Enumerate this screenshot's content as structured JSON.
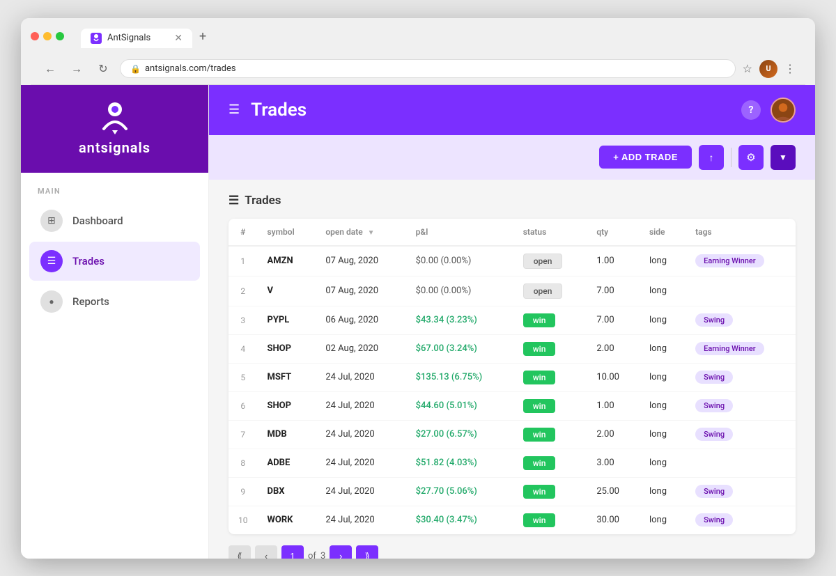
{
  "browser": {
    "tab_title": "AntSignals",
    "tab_favicon": "a",
    "url": "antsignals.com/trades",
    "new_tab_symbol": "+"
  },
  "sidebar": {
    "logo_text_light": "ant",
    "logo_text_bold": "signals",
    "section_label": "MAIN",
    "items": [
      {
        "id": "dashboard",
        "label": "Dashboard",
        "icon": "⊞",
        "active": false
      },
      {
        "id": "trades",
        "label": "Trades",
        "icon": "☰",
        "active": true
      },
      {
        "id": "reports",
        "label": "Reports",
        "icon": "○",
        "active": false
      }
    ]
  },
  "header": {
    "title": "Trades",
    "hamburger": "☰",
    "help_label": "?",
    "user_initials": "U"
  },
  "toolbar": {
    "add_trade_label": "+ ADD TRADE",
    "upload_icon": "↑",
    "settings_icon": "⚙",
    "filter_icon": "▼"
  },
  "trades_section": {
    "heading": "Trades",
    "heading_icon": "☰",
    "columns": [
      "#",
      "symbol",
      "open date",
      "p&l",
      "status",
      "qty",
      "side",
      "tags"
    ],
    "rows": [
      {
        "num": 1,
        "symbol": "AMZN",
        "open_date": "07 Aug, 2020",
        "pnl": "$0.00 (0.00%)",
        "pnl_type": "zero",
        "status": "open",
        "qty": "1.00",
        "side": "long",
        "tags": [
          "Earning Winner"
        ]
      },
      {
        "num": 2,
        "symbol": "V",
        "open_date": "07 Aug, 2020",
        "pnl": "$0.00 (0.00%)",
        "pnl_type": "zero",
        "status": "open",
        "qty": "7.00",
        "side": "long",
        "tags": []
      },
      {
        "num": 3,
        "symbol": "PYPL",
        "open_date": "06 Aug, 2020",
        "pnl": "$43.34 (3.23%)",
        "pnl_type": "win",
        "status": "win",
        "qty": "7.00",
        "side": "long",
        "tags": [
          "Swing"
        ]
      },
      {
        "num": 4,
        "symbol": "SHOP",
        "open_date": "02 Aug, 2020",
        "pnl": "$67.00 (3.24%)",
        "pnl_type": "win",
        "status": "win",
        "qty": "2.00",
        "side": "long",
        "tags": [
          "Earning Winner"
        ]
      },
      {
        "num": 5,
        "symbol": "MSFT",
        "open_date": "24 Jul, 2020",
        "pnl": "$135.13 (6.75%)",
        "pnl_type": "win",
        "status": "win",
        "qty": "10.00",
        "side": "long",
        "tags": [
          "Swing"
        ]
      },
      {
        "num": 6,
        "symbol": "SHOP",
        "open_date": "24 Jul, 2020",
        "pnl": "$44.60 (5.01%)",
        "pnl_type": "win",
        "status": "win",
        "qty": "1.00",
        "side": "long",
        "tags": [
          "Swing"
        ]
      },
      {
        "num": 7,
        "symbol": "MDB",
        "open_date": "24 Jul, 2020",
        "pnl": "$27.00 (6.57%)",
        "pnl_type": "win",
        "status": "win",
        "qty": "2.00",
        "side": "long",
        "tags": [
          "Swing"
        ]
      },
      {
        "num": 8,
        "symbol": "ADBE",
        "open_date": "24 Jul, 2020",
        "pnl": "$51.82 (4.03%)",
        "pnl_type": "win",
        "status": "win",
        "qty": "3.00",
        "side": "long",
        "tags": []
      },
      {
        "num": 9,
        "symbol": "DBX",
        "open_date": "24 Jul, 2020",
        "pnl": "$27.70 (5.06%)",
        "pnl_type": "win",
        "status": "win",
        "qty": "25.00",
        "side": "long",
        "tags": [
          "Swing"
        ]
      },
      {
        "num": 10,
        "symbol": "WORK",
        "open_date": "24 Jul, 2020",
        "pnl": "$30.40 (3.47%)",
        "pnl_type": "win",
        "status": "win",
        "qty": "30.00",
        "side": "long",
        "tags": [
          "Swing"
        ]
      }
    ]
  },
  "pagination": {
    "current_page": "1",
    "total_pages": "3",
    "of_label": "of"
  }
}
